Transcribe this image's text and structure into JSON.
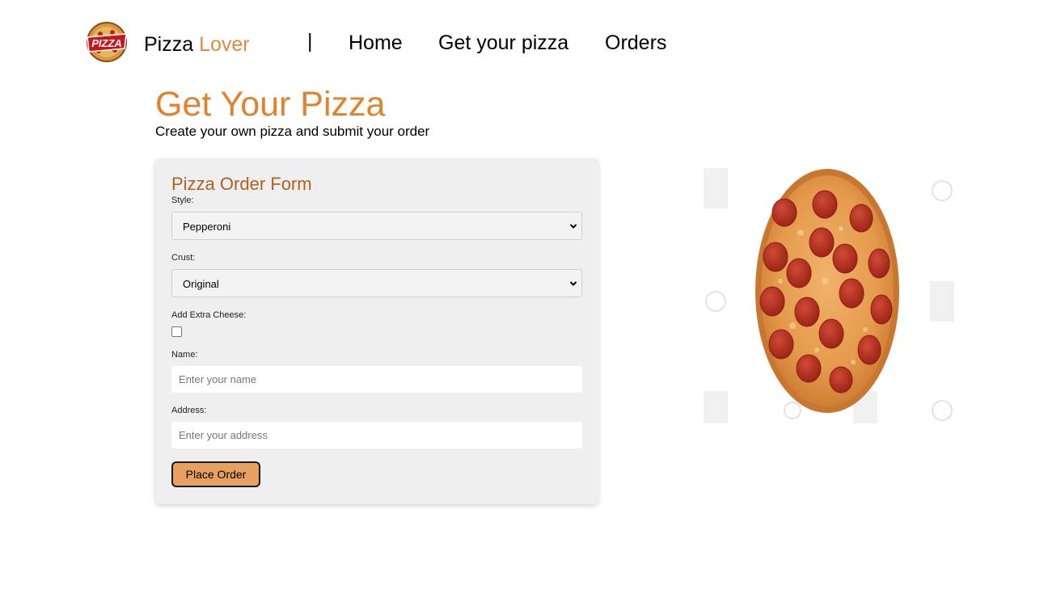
{
  "header": {
    "brand_first": "Pizza",
    "brand_second": "Lover",
    "divider": "|",
    "nav": {
      "home": "Home",
      "get_pizza": "Get your pizza",
      "orders": "Orders"
    }
  },
  "logo": {
    "text": "PIZZA"
  },
  "page": {
    "title": "Get Your Pizza",
    "subtitle": "Create your own pizza and submit your order"
  },
  "form": {
    "title": "Pizza Order Form",
    "style": {
      "label": "Style:",
      "value": "Pepperoni"
    },
    "crust": {
      "label": "Crust:",
      "value": "Original"
    },
    "extra_cheese": {
      "label": "Add Extra Cheese:",
      "checked": false
    },
    "name": {
      "label": "Name:",
      "placeholder": "Enter your name",
      "value": ""
    },
    "address": {
      "label": "Address:",
      "placeholder": "Enter your address",
      "value": ""
    },
    "submit_label": "Place Order"
  },
  "colors": {
    "brand_accent": "#e08a3a",
    "title": "#e0822e",
    "form_title": "#b65f1c",
    "button_bg": "#e8a060",
    "card_bg": "#efefef"
  },
  "icons": {
    "logo": "pizza-logo-icon",
    "caret": "chevron-down-icon",
    "pizza": "pepperoni-pizza-image"
  }
}
